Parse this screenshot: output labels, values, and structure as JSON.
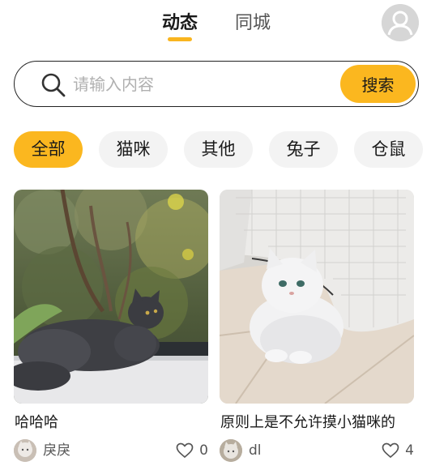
{
  "header": {
    "tab_active": "动态",
    "tab_inactive": "同城"
  },
  "search": {
    "placeholder": "请输入内容",
    "button_label": "搜索"
  },
  "categories": [
    {
      "label": "全部",
      "active": true
    },
    {
      "label": "猫咪",
      "active": false
    },
    {
      "label": "其他",
      "active": false
    },
    {
      "label": "兔子",
      "active": false
    },
    {
      "label": "仓鼠",
      "active": false
    }
  ],
  "posts": [
    {
      "title": "哈哈哈",
      "author": "戾戾",
      "likes": "0"
    },
    {
      "title": "原则上是不允许摸小猫咪的",
      "author": "dl",
      "likes": "4"
    }
  ],
  "colors": {
    "accent": "#fbb71f"
  },
  "icons": [
    "user-avatar-icon",
    "search-icon",
    "heart-icon"
  ]
}
